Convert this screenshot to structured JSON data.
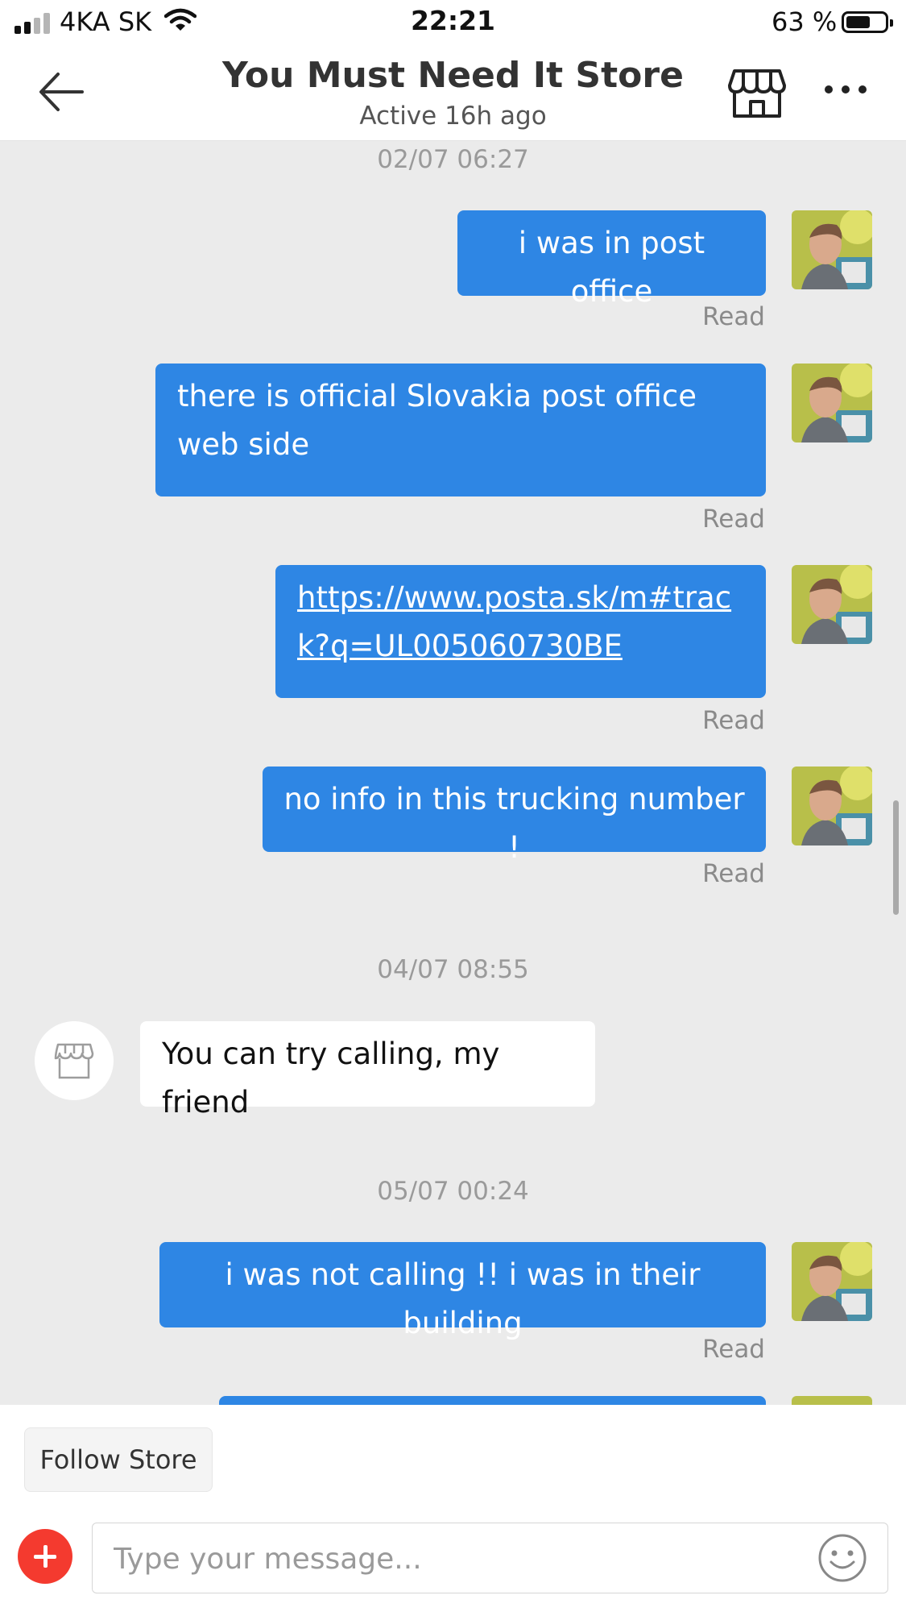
{
  "status_bar": {
    "carrier": "4KA SK",
    "time": "22:21",
    "battery_pct": "63 %",
    "battery_level": 0.63,
    "signal_bars": 2
  },
  "header": {
    "title": "You Must Need It Store",
    "subtitle": "Active 16h ago",
    "icons": [
      "back-arrow-icon",
      "store-icon",
      "more-icon"
    ]
  },
  "messages": [
    {
      "type": "timestamp",
      "text": "02/07 06:27"
    },
    {
      "type": "outgoing",
      "text": "i was in post office",
      "status": "Read"
    },
    {
      "type": "outgoing",
      "text": "there is official Slovakia post office web side",
      "status": "Read"
    },
    {
      "type": "outgoing",
      "link": true,
      "text": "https://www.posta.sk/m#track?q=UL005060730BE",
      "status": "Read"
    },
    {
      "type": "outgoing",
      "text": "no info in this trucking number !",
      "status": "Read"
    },
    {
      "type": "timestamp",
      "text": "04/07 08:55"
    },
    {
      "type": "incoming",
      "text": "You can try calling, my friend"
    },
    {
      "type": "timestamp",
      "text": "05/07 00:24"
    },
    {
      "type": "outgoing",
      "text": "i was not calling !! i was in their building",
      "status": "Read"
    }
  ],
  "footer": {
    "follow_label": "Follow Store",
    "input_placeholder": "Type your message...",
    "input_value": ""
  },
  "colors": {
    "outgoing_bubble": "#2e86e4",
    "incoming_bubble": "#ffffff",
    "chat_background": "#ebebeb",
    "plus_button": "#f43a2f"
  }
}
